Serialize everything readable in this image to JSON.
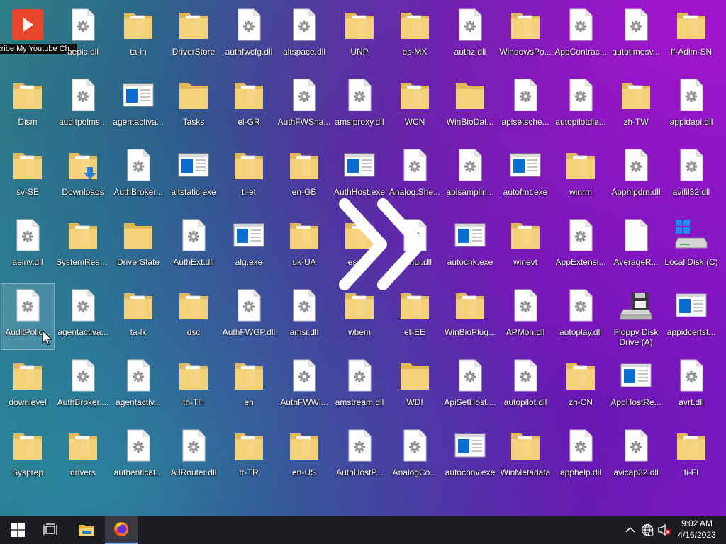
{
  "desktop": {
    "columns": [
      [
        {
          "label": "Subscribe My Youtube Ch...",
          "type": "youtube"
        },
        {
          "label": "Dism",
          "type": "folder-doc"
        },
        {
          "label": "sv-SE",
          "type": "folder-doc"
        },
        {
          "label": "aeinv.dll",
          "type": "dll"
        },
        {
          "label": "AuditPolic...",
          "type": "dll",
          "selected": true
        },
        {
          "label": "downlevel",
          "type": "folder-doc"
        },
        {
          "label": "Sysprep",
          "type": "folder-doc"
        }
      ],
      [
        {
          "label": "aepic.dll",
          "type": "dll"
        },
        {
          "label": "auditpolms...",
          "type": "dll"
        },
        {
          "label": "Downloads",
          "type": "downloads"
        },
        {
          "label": "SystemRese...",
          "type": "folder-doc"
        },
        {
          "label": "agentactiva...",
          "type": "dll"
        },
        {
          "label": "AuthBroker....",
          "type": "dll"
        },
        {
          "label": "drivers",
          "type": "folder-doc"
        }
      ],
      [
        {
          "label": "ta-in",
          "type": "folder-doc"
        },
        {
          "label": "agentactiva...",
          "type": "exe"
        },
        {
          "label": "AuthBroker...",
          "type": "dll"
        },
        {
          "label": "DriverState",
          "type": "folder"
        },
        {
          "label": "ta-lk",
          "type": "folder-doc"
        },
        {
          "label": "agentactiv...",
          "type": "dll"
        },
        {
          "label": "authenticat...",
          "type": "dll"
        }
      ],
      [
        {
          "label": "DriverStore",
          "type": "folder-doc"
        },
        {
          "label": "Tasks",
          "type": "folder"
        },
        {
          "label": "aitstatic.exe",
          "type": "exe"
        },
        {
          "label": "AuthExt.dll",
          "type": "dll"
        },
        {
          "label": "dsc",
          "type": "folder-doc"
        },
        {
          "label": "th-TH",
          "type": "folder-doc"
        },
        {
          "label": "AJRouter.dll",
          "type": "dll"
        }
      ],
      [
        {
          "label": "authfwcfg.dll",
          "type": "dll"
        },
        {
          "label": "el-GR",
          "type": "folder-doc"
        },
        {
          "label": "ti-et",
          "type": "folder-doc"
        },
        {
          "label": "alg.exe",
          "type": "exe"
        },
        {
          "label": "AuthFWGP.dll",
          "type": "dll"
        },
        {
          "label": "en",
          "type": "folder-doc"
        },
        {
          "label": "tr-TR",
          "type": "folder-doc"
        }
      ],
      [
        {
          "label": "altspace.dll",
          "type": "dll"
        },
        {
          "label": "AuthFWSna...",
          "type": "dll"
        },
        {
          "label": "en-GB",
          "type": "folder-doc"
        },
        {
          "label": "uk-UA",
          "type": "folder-doc"
        },
        {
          "label": "amsi.dll",
          "type": "dll"
        },
        {
          "label": "AuthFWWi...",
          "type": "dll"
        },
        {
          "label": "en-US",
          "type": "folder-doc"
        }
      ],
      [
        {
          "label": "UNP",
          "type": "folder-doc"
        },
        {
          "label": "amsiproxy.dll",
          "type": "dll"
        },
        {
          "label": "AuthHost.exe",
          "type": "exe"
        },
        {
          "label": "es-ES",
          "type": "folder-doc"
        },
        {
          "label": "wbem",
          "type": "folder-doc"
        },
        {
          "label": "amstream.dll",
          "type": "dll"
        },
        {
          "label": "AuthHostP...",
          "type": "dll"
        }
      ],
      [
        {
          "label": "es-MX",
          "type": "folder-doc"
        },
        {
          "label": "WCN",
          "type": "folder-doc"
        },
        {
          "label": "Analog.She...",
          "type": "dll"
        },
        {
          "label": "authui.dll",
          "type": "dll"
        },
        {
          "label": "et-EE",
          "type": "folder-doc"
        },
        {
          "label": "WDI",
          "type": "folder"
        },
        {
          "label": "AnalogCo...",
          "type": "dll"
        }
      ],
      [
        {
          "label": "authz.dll",
          "type": "dll"
        },
        {
          "label": "WinBioDat...",
          "type": "folder"
        },
        {
          "label": "apisamplin...",
          "type": "dll"
        },
        {
          "label": "autochk.exe",
          "type": "exe"
        },
        {
          "label": "WinBioPlug...",
          "type": "folder-doc"
        },
        {
          "label": "ApiSetHost....",
          "type": "dll"
        },
        {
          "label": "autoconv.exe",
          "type": "exe"
        }
      ],
      [
        {
          "label": "WindowsPo...",
          "type": "folder-doc"
        },
        {
          "label": "apisetsche...",
          "type": "dll"
        },
        {
          "label": "autofmt.exe",
          "type": "exe"
        },
        {
          "label": "winevt",
          "type": "folder-doc"
        },
        {
          "label": "APMon.dll",
          "type": "dll"
        },
        {
          "label": "autopilot.dll",
          "type": "dll"
        },
        {
          "label": "WinMetadata",
          "type": "folder-doc"
        }
      ],
      [
        {
          "label": "AppContrac...",
          "type": "dll"
        },
        {
          "label": "autopilotdia...",
          "type": "dll"
        },
        {
          "label": "winrm",
          "type": "folder-doc"
        },
        {
          "label": "AppExtensi...",
          "type": "dll"
        },
        {
          "label": "autoplay.dll",
          "type": "dll"
        },
        {
          "label": "zh-CN",
          "type": "folder-doc"
        },
        {
          "label": "apphelp.dll",
          "type": "dll"
        }
      ],
      [
        {
          "label": "autotimesv...",
          "type": "dll"
        },
        {
          "label": "zh-TW",
          "type": "folder-doc"
        },
        {
          "label": "Apphlpdm.dll",
          "type": "dll"
        },
        {
          "label": "AverageR...",
          "type": "blank"
        },
        {
          "label": "Floppy Disk Drive (A)",
          "type": "floppy",
          "wrap": true
        },
        {
          "label": "AppHostRe...",
          "type": "exe"
        },
        {
          "label": "avicap32.dll",
          "type": "dll"
        }
      ],
      [
        {
          "label": "ff-Adlm-SN",
          "type": "folder-doc"
        },
        {
          "label": "appidapi.dll",
          "type": "dll"
        },
        {
          "label": "avifil32.dll",
          "type": "dll"
        },
        {
          "label": "Local Disk (C)",
          "type": "localdisk"
        },
        {
          "label": "appidcertst...",
          "type": "exe"
        },
        {
          "label": "avrt.dll",
          "type": "dll"
        },
        {
          "label": "fi-FI",
          "type": "folder-doc"
        }
      ]
    ]
  },
  "taskbar": {
    "start_icon": "windows-logo-icon",
    "task_view_icon": "task-view-icon",
    "explorer_icon": "file-explorer-icon",
    "firefox_icon": "firefox-icon",
    "tray_chevron_icon": "chevron-up-icon",
    "network_icon": "globe-network-icon",
    "volume_icon": "volume-muted-icon",
    "time": "9:02 AM",
    "date": "4/16/2023"
  },
  "colors": {
    "folder": "#f4d27a",
    "folder_dark": "#e3b955",
    "exe_blue": "#0a6ed1",
    "youtube_red": "#e8452c",
    "taskbar": "#1c1d22"
  }
}
